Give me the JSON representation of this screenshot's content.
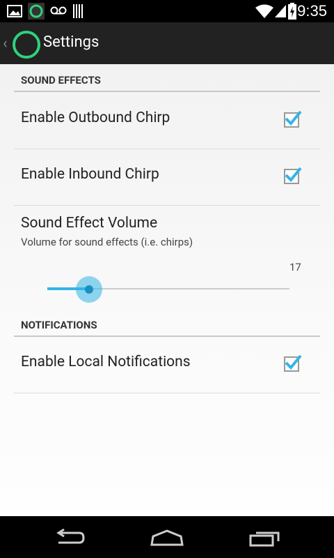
{
  "status_bar": {
    "time": "9:35",
    "icons": [
      "image-icon",
      "app-ring-icon",
      "voicemail-icon",
      "barcode-icon",
      "wifi-icon",
      "signal-icon",
      "battery-charging-icon"
    ]
  },
  "action_bar": {
    "title": "Settings",
    "back_icon": "back-chevron-icon",
    "logo_icon": "app-ring-icon"
  },
  "sections": {
    "sound_effects": {
      "header": "SOUND EFFECTS",
      "outbound": {
        "label": "Enable Outbound Chirp",
        "checked": true
      },
      "inbound": {
        "label": "Enable Inbound Chirp",
        "checked": true
      },
      "volume": {
        "title": "Sound Effect Volume",
        "summary": "Volume for sound effects (i.e. chirps)",
        "value": "17"
      }
    },
    "notifications": {
      "header": "NOTIFICATIONS",
      "local": {
        "label": "Enable Local Notifications",
        "checked": true
      }
    }
  },
  "navigation_bar": {
    "buttons": [
      "back-icon",
      "home-icon",
      "recents-icon"
    ]
  },
  "colors": {
    "accent": "#33b5e5",
    "logo": "#2fd27a",
    "action_bar": "#222222"
  }
}
